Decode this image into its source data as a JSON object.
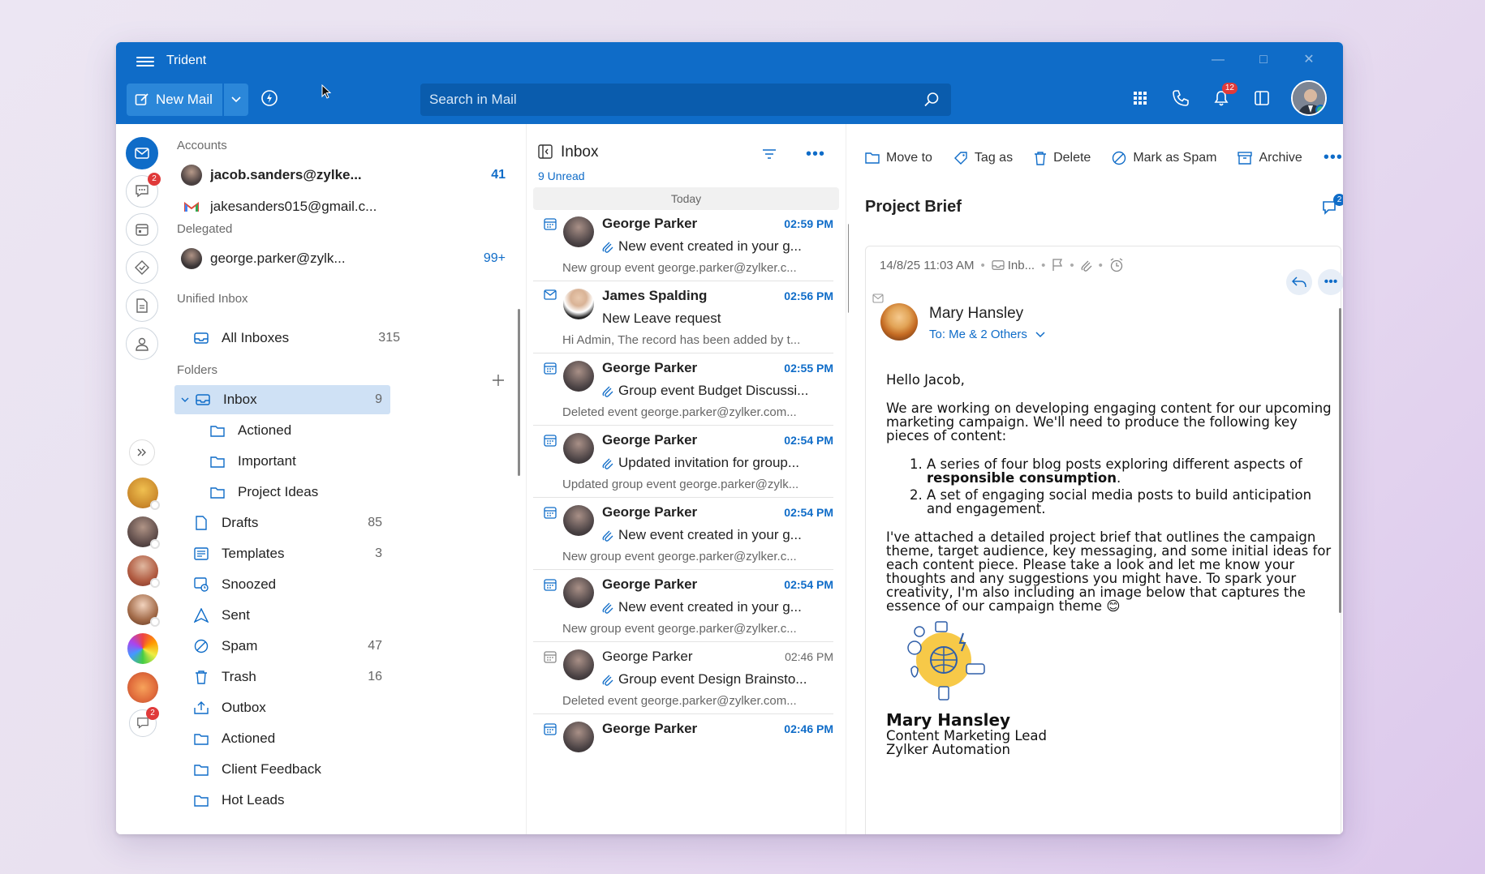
{
  "app": {
    "title": "Trident"
  },
  "header": {
    "new_mail": "New Mail",
    "search_placeholder": "Search in Mail",
    "notification_count": "12"
  },
  "rail": {
    "chat_badge": "2",
    "bottom_badge": "2"
  },
  "folders": {
    "accounts_label": "Accounts",
    "accounts": [
      {
        "email": "jacob.sanders@zylke...",
        "count": "41"
      },
      {
        "email": "jakesanders015@gmail.c..."
      }
    ],
    "delegated_label": "Delegated",
    "delegated": {
      "email": "george.parker@zylk...",
      "count": "99+"
    },
    "unified_label": "Unified Inbox",
    "all_inboxes": {
      "name": "All Inboxes",
      "count": "315"
    },
    "folders_label": "Folders",
    "items": [
      {
        "name": "Inbox",
        "count": "9"
      },
      {
        "name": "Actioned",
        "count": ""
      },
      {
        "name": "Important",
        "count": ""
      },
      {
        "name": "Project Ideas",
        "count": ""
      },
      {
        "name": "Drafts",
        "count": "85"
      },
      {
        "name": "Templates",
        "count": "3"
      },
      {
        "name": "Snoozed",
        "count": ""
      },
      {
        "name": "Sent",
        "count": ""
      },
      {
        "name": "Spam",
        "count": "47"
      },
      {
        "name": "Trash",
        "count": "16"
      },
      {
        "name": "Outbox",
        "count": ""
      },
      {
        "name": "Actioned",
        "count": ""
      },
      {
        "name": "Client Feedback",
        "count": ""
      },
      {
        "name": "Hot Leads",
        "count": ""
      }
    ]
  },
  "list": {
    "title": "Inbox",
    "unread": "9 Unread",
    "day": "Today",
    "mails": [
      {
        "from": "George Parker",
        "time": "02:59 PM",
        "subject": "New event created in your g...",
        "preview": "New group event george.parker@zylker.c..."
      },
      {
        "from": "James Spalding",
        "time": "02:56 PM",
        "subject": "New Leave request",
        "preview": "Hi Admin, The record has been added by t..."
      },
      {
        "from": "George Parker",
        "time": "02:55 PM",
        "subject": "Group event Budget Discussi...",
        "preview": "Deleted event george.parker@zylker.com..."
      },
      {
        "from": "George Parker",
        "time": "02:54 PM",
        "subject": "Updated invitation for group...",
        "preview": "Updated group event george.parker@zylk..."
      },
      {
        "from": "George Parker",
        "time": "02:54 PM",
        "subject": "New event created in your g...",
        "preview": "New group event george.parker@zylker.c..."
      },
      {
        "from": "George Parker",
        "time": "02:54 PM",
        "subject": "New event created in your g...",
        "preview": "New group event george.parker@zylker.c..."
      },
      {
        "from": "George Parker",
        "time": "02:46 PM",
        "subject": "Group event Design Brainsto...",
        "preview": "Deleted event george.parker@zylker.com..."
      },
      {
        "from": "George Parker",
        "time": "02:46 PM",
        "subject": "",
        "preview": ""
      }
    ]
  },
  "reader": {
    "toolbar": {
      "move": "Move to",
      "tag": "Tag as",
      "delete": "Delete",
      "spam": "Mark as Spam",
      "archive": "Archive"
    },
    "subject": "Project Brief",
    "thread_count": "2",
    "meta": {
      "date": "14/8/25 11:03 AM",
      "folder": "Inb..."
    },
    "sender": "Mary Hansley",
    "to": "To: Me & 2 Others",
    "body": {
      "greeting": "Hello Jacob,",
      "intro": "We are working on developing engaging content for our upcoming marketing campaign. We'll need to produce the following key pieces of content:",
      "item1_pre": "A series of four blog posts exploring different aspects of ",
      "item1_bold": "responsible consumption",
      "item1_post": ".",
      "item2": "A set of engaging social media posts to build anticipation and engagement.",
      "closing": "I've attached a detailed project brief that outlines the campaign theme, target audience, key messaging, and some initial ideas for each content piece. Please take a look and let me know your thoughts and any suggestions you might have. To spark your creativity, I'm also including an image below that captures the essence of our campaign theme 😊"
    },
    "signature": {
      "name": "Mary Hansley",
      "role": "Content Marketing Lead",
      "company": "Zylker Automation"
    }
  },
  "colors": {
    "brand": "#0f6cc8",
    "badge": "#e03a3a",
    "selected": "#cfe1f5"
  }
}
